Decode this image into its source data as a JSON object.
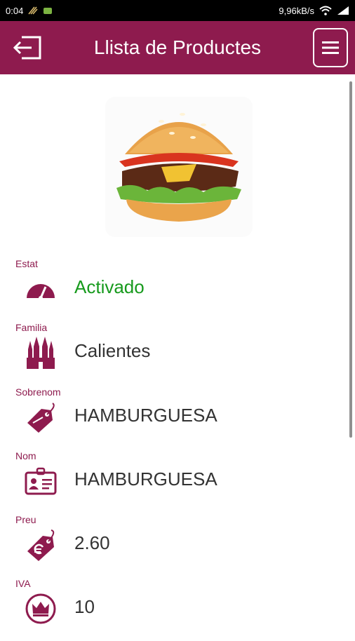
{
  "status_bar": {
    "time": "0:04",
    "speed": "9,96kB/s"
  },
  "header": {
    "title": "Llista de Productes"
  },
  "colors": {
    "brand": "#8e1b4e",
    "active": "#179a1d",
    "text": "#333333"
  },
  "product": {
    "image": "burger-image",
    "fields": [
      {
        "label": "Estat",
        "icon": "speedometer-icon",
        "value": "Activado"
      },
      {
        "label": "Familia",
        "icon": "cathedral-icon",
        "value": "Calientes"
      },
      {
        "label": "Sobrenom",
        "icon": "tag-icon",
        "value": "HAMBURGUESA"
      },
      {
        "label": "Nom",
        "icon": "id-card-icon",
        "value": "HAMBURGUESA"
      },
      {
        "label": "Preu",
        "icon": "euro-tag-icon",
        "value": "2.60"
      },
      {
        "label": "IVA",
        "icon": "crown-icon",
        "value": "10"
      }
    ]
  }
}
